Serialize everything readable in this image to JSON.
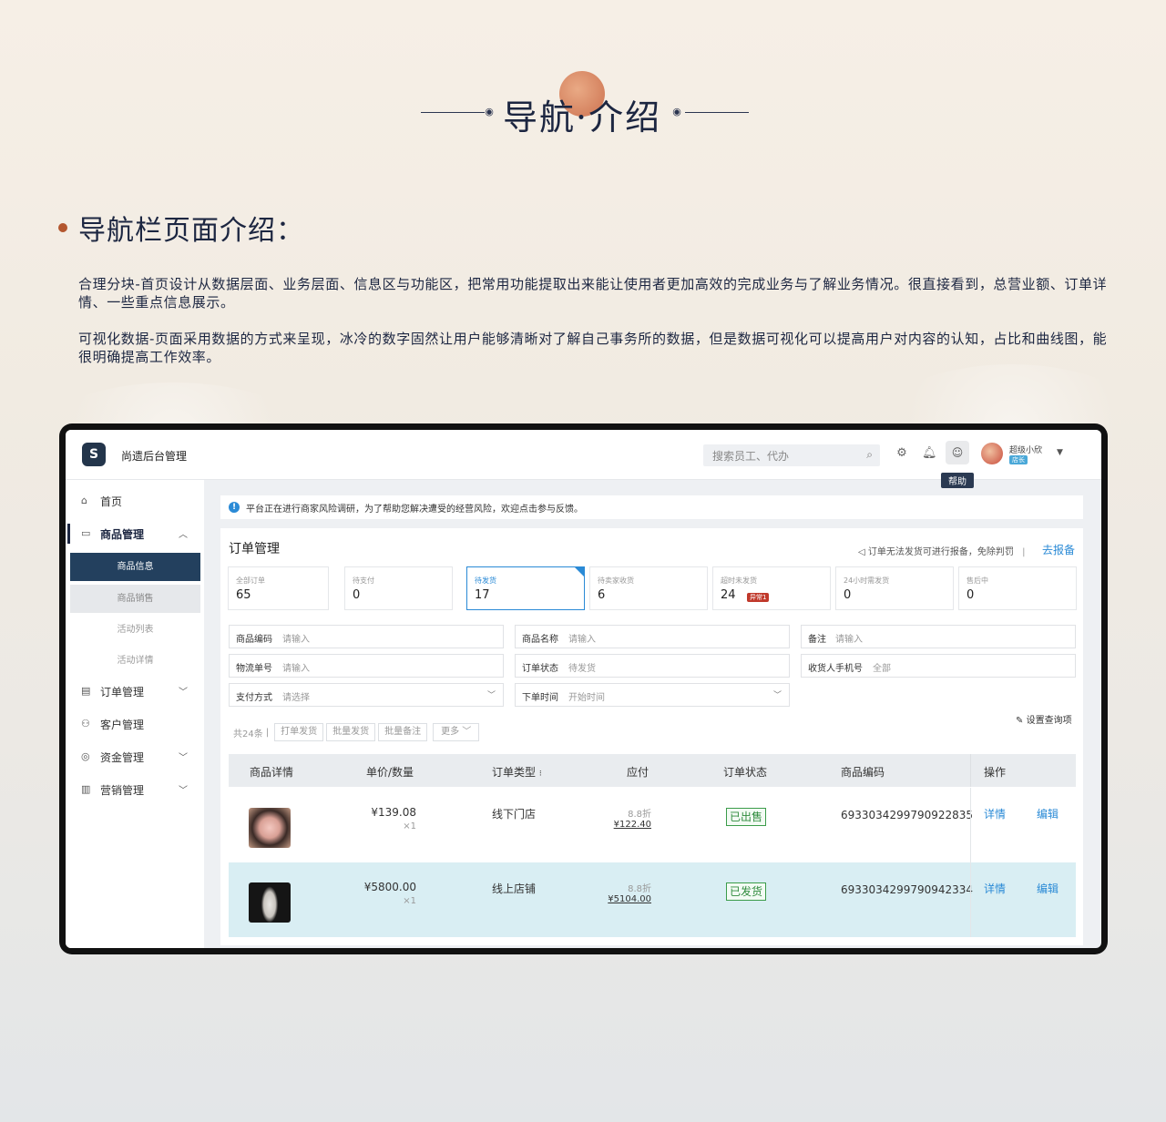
{
  "hero": {
    "title": "导航·介绍"
  },
  "section": {
    "title": "导航栏页面介绍："
  },
  "paragraphs": [
    "合理分块-首页设计从数据层面、业务层面、信息区与功能区，把常用功能提取出来能让使用者更加高效的完成业务与了解业务情况。很直接看到，总营业额、订单详情、一些重点信息展示。",
    "可视化数据-页面采用数据的方式来呈现，冰冷的数字固然让用户能够清晰对了解自己事务所的数据，但是数据可视化可以提高用户对内容的认知，占比和曲线图，能很明确提高工作效率。"
  ],
  "app": {
    "logo": "S",
    "title": "尚遗后台管理",
    "search_placeholder": "搜索员工、代办",
    "help_tip": "帮助",
    "user_name": "超级小欣",
    "user_tag": "店长"
  },
  "sidebar": {
    "items": [
      {
        "icon": "home-icon",
        "label": "首页"
      },
      {
        "icon": "goods-icon",
        "label": "商品管理"
      },
      {
        "icon": "order-icon",
        "label": "订单管理"
      },
      {
        "icon": "customer-icon",
        "label": "客户管理"
      },
      {
        "icon": "money-icon",
        "label": "资金管理"
      },
      {
        "icon": "marketing-icon",
        "label": "营销管理"
      }
    ],
    "sub_items": [
      "商品信息",
      "商品销售",
      "活动列表",
      "活动详情"
    ]
  },
  "notice": "平台正在进行商家风险调研，为了帮助您解决遭受的经营风险，欢迎点击参与反馈。",
  "panel": {
    "title": "订单管理",
    "warning": "订单无法发货可进行报备，免除判罚",
    "report_link": "去报备",
    "stats": [
      {
        "label": "全部订单",
        "value": "65"
      },
      {
        "label": "待支付",
        "value": "0"
      },
      {
        "label": "待发货",
        "value": "17"
      },
      {
        "label": "待卖家收货",
        "value": "6"
      },
      {
        "label": "超时未发货",
        "value": "24",
        "badge": "异常1"
      },
      {
        "label": "24小时需发货",
        "value": "0"
      },
      {
        "label": "售后中",
        "value": "0"
      }
    ],
    "filters": {
      "product_code": {
        "label": "商品编码",
        "value": "请输入"
      },
      "product_name": {
        "label": "商品名称",
        "value": "请输入"
      },
      "remark": {
        "label": "备注",
        "value": "请输入"
      },
      "tracking_no": {
        "label": "物流单号",
        "value": "请输入"
      },
      "order_status": {
        "label": "订单状态",
        "value": "待发货"
      },
      "receiver_phone": {
        "label": "收货人手机号",
        "value": "全部"
      },
      "payment": {
        "label": "支付方式",
        "value": "请选择"
      },
      "order_time": {
        "label": "下单时间",
        "value": "开始时间"
      }
    },
    "settings": "设置查询项",
    "toolbar": {
      "count": "共24条",
      "print_ship": "打单发货",
      "batch_ship": "批量发货",
      "batch_remark": "批量备注",
      "more": "更多"
    },
    "columns": [
      "商品详情",
      "单价/数量",
      "订单类型",
      "应付",
      "订单状态",
      "商品编码",
      "操作"
    ],
    "rows": [
      {
        "price": "¥139.08",
        "qty": "×1",
        "type": "线下门店",
        "discount": "8.8折",
        "paid": "¥122.40",
        "status": "已出售",
        "code": "6933034299790922835",
        "detail": "详情",
        "edit": "编辑"
      },
      {
        "price": "¥5800.00",
        "qty": "×1",
        "type": "线上店铺",
        "discount": "8.8折",
        "paid": "¥5104.00",
        "status": "已发货",
        "code": "6933034299790942334",
        "detail": "详情",
        "edit": "编辑"
      }
    ]
  }
}
